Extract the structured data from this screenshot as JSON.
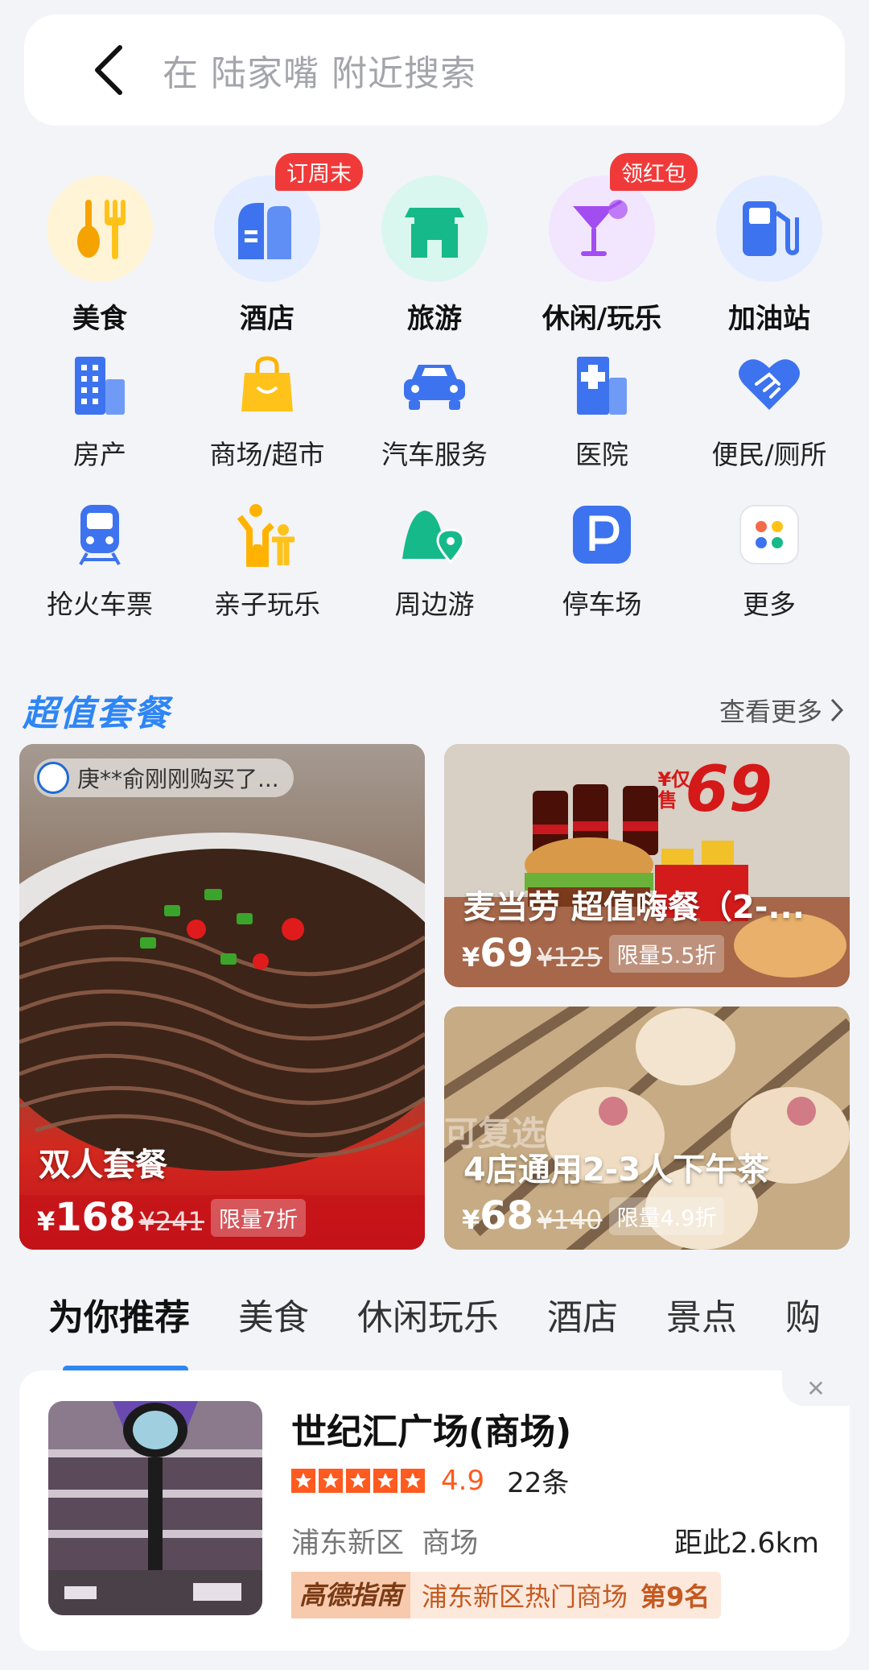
{
  "search": {
    "placeholder": "在 陆家嘴 附近搜索"
  },
  "categories_primary": [
    {
      "label": "美食",
      "icon": "food-icon",
      "badge": ""
    },
    {
      "label": "酒店",
      "icon": "hotel-icon",
      "badge": "订周末"
    },
    {
      "label": "旅游",
      "icon": "travel-icon",
      "badge": ""
    },
    {
      "label": "休闲/玩乐",
      "icon": "cocktail-icon",
      "badge": "领红包"
    },
    {
      "label": "加油站",
      "icon": "gas-station-icon",
      "badge": ""
    }
  ],
  "categories_secondary": [
    {
      "label": "房产",
      "icon": "building-icon"
    },
    {
      "label": "商场/超市",
      "icon": "shopping-bag-icon"
    },
    {
      "label": "汽车服务",
      "icon": "car-icon"
    },
    {
      "label": "医院",
      "icon": "hospital-icon"
    },
    {
      "label": "便民/厕所",
      "icon": "handshake-heart-icon"
    },
    {
      "label": "抢火车票",
      "icon": "train-icon"
    },
    {
      "label": "亲子玩乐",
      "icon": "parent-child-icon"
    },
    {
      "label": "周边游",
      "icon": "mountain-pin-icon"
    },
    {
      "label": "停车场",
      "icon": "parking-icon"
    },
    {
      "label": "更多",
      "icon": "more-grid-icon"
    }
  ],
  "deals": {
    "title": "超值套餐",
    "more": "查看更多",
    "items": [
      {
        "title": "双人套餐",
        "currency": "¥",
        "price": "168",
        "original": "¥241",
        "discount": "限量7折",
        "bought": "庚**俞刚刚购买了..."
      },
      {
        "title": "麦当劳 超值嗨餐（2-...",
        "currency": "¥",
        "price": "69",
        "original": "¥125",
        "discount": "限量5.5折",
        "promo_big": "69",
        "promo_small": "¥仅售"
      },
      {
        "title": "4店通用2-3人下午茶",
        "currency": "¥",
        "price": "68",
        "original": "¥140",
        "discount": "限量4.9折",
        "overlay_text": "可复选"
      }
    ]
  },
  "tabs": [
    "为你推荐",
    "美食",
    "休闲玩乐",
    "酒店",
    "景点",
    "购"
  ],
  "recommendation": {
    "name": "世纪汇广场(商场)",
    "rating": "4.9",
    "rating_value": 4.9,
    "reviews": "22条",
    "area": "浦东新区",
    "type": "商场",
    "distance": "距此2.6km",
    "guide_logo": "高德指南",
    "guide_text": "浦东新区热门商场",
    "guide_rank": "第9名"
  },
  "colors": {
    "accent": "#2e86f5",
    "badge": "#f03a3a",
    "rating": "#ff5a1f"
  }
}
